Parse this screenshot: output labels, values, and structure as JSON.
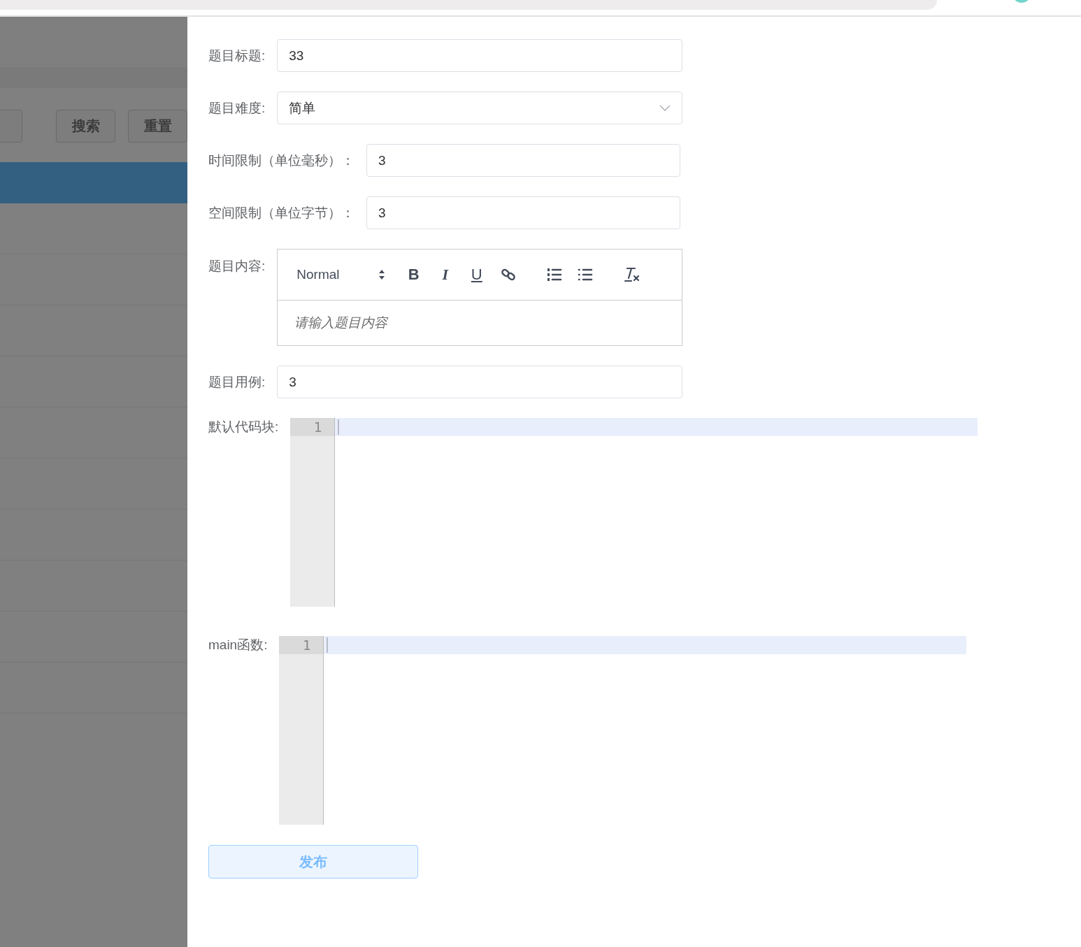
{
  "background_page": {
    "buttons": [
      "搜索",
      "重置"
    ]
  },
  "form": {
    "fields": [
      {
        "kind": "input",
        "label": "题目标题:",
        "value": "33"
      },
      {
        "kind": "select",
        "label": "题目难度:",
        "value": "简单"
      },
      {
        "kind": "input_narrow",
        "label": "时间限制（单位毫秒）：",
        "value": "3"
      },
      {
        "kind": "input_narrow",
        "label": "空间限制（单位字节）：",
        "value": "3"
      },
      {
        "kind": "rich_editor",
        "label": "题目内容:",
        "header": "Normal",
        "formats": [
          {
            "kind": "bold",
            "label": "B"
          },
          {
            "kind": "italic",
            "label": "I"
          },
          {
            "kind": "underline",
            "label": "U"
          }
        ],
        "placeholder": "请输入题目内容"
      },
      {
        "kind": "input",
        "label": "题目用例:",
        "value": "3"
      },
      {
        "kind": "code",
        "label": "默认代码块:",
        "line_numbers": [
          "1"
        ]
      },
      {
        "kind": "code",
        "label": "main函数:",
        "line_numbers": [
          "1"
        ]
      }
    ],
    "submit": "发布"
  }
}
